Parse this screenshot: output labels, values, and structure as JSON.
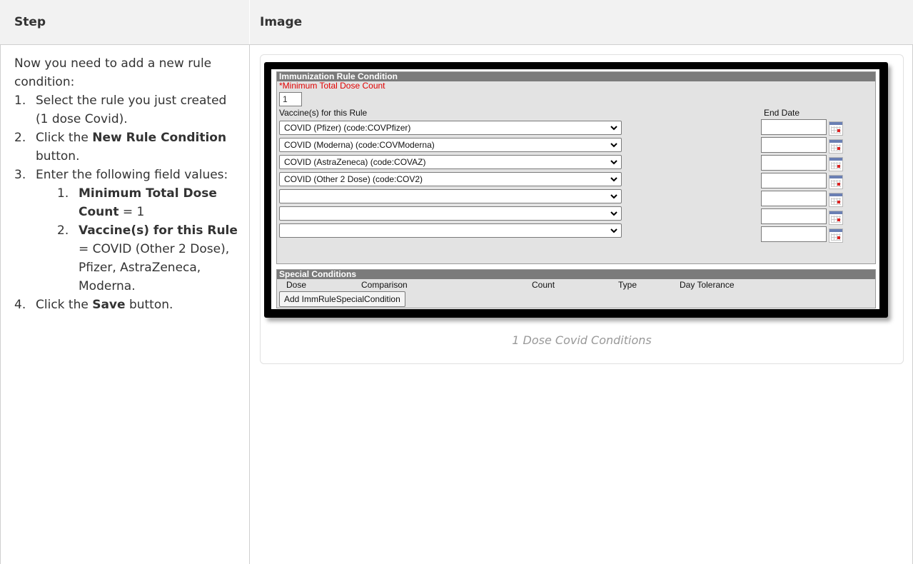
{
  "table": {
    "col_step": "Step",
    "col_image": "Image"
  },
  "step": {
    "intro": "Now you need to add a new rule condition:",
    "items": [
      {
        "num": "1.",
        "text": "Select the rule you just created (1 dose Covid)."
      },
      {
        "num": "2.",
        "pre": "Click the ",
        "bold": "New Rule Condition",
        "post": " button."
      },
      {
        "num": "3.",
        "text": "Enter the following field values:"
      },
      {
        "num": "4.",
        "pre": "Click the ",
        "bold": "Save",
        "post": " button."
      }
    ],
    "subitems": [
      {
        "num": "1.",
        "bold": "Minimum Total Dose Count",
        "post": " = 1"
      },
      {
        "num": "2.",
        "bold": "Vaccine(s) for this Rule",
        "post": " = COVID (Other 2 Dose), Pfizer, AstraZeneca, Moderna."
      }
    ]
  },
  "figure": {
    "caption": "1 Dose Covid Conditions",
    "panel_title": "Immunization Rule Condition",
    "min_dose_label": "*Minimum Total Dose Count",
    "min_dose_value": "1",
    "vaccines_label": "Vaccine(s) for this Rule",
    "end_date_label": "End Date",
    "vaccines": [
      "COVID (Pfizer) (code:COVPfizer)",
      "COVID (Moderna) (code:COVModerna)",
      "COVID (AstraZeneca) (code:COVAZ)",
      "COVID (Other 2 Dose) (code:COV2)",
      "",
      "",
      ""
    ],
    "special_title": "Special Conditions",
    "special_headers": [
      "Dose",
      "Comparison",
      "Count",
      "Type",
      "Day Tolerance"
    ],
    "add_button": "Add ImmRuleSpecialCondition"
  }
}
